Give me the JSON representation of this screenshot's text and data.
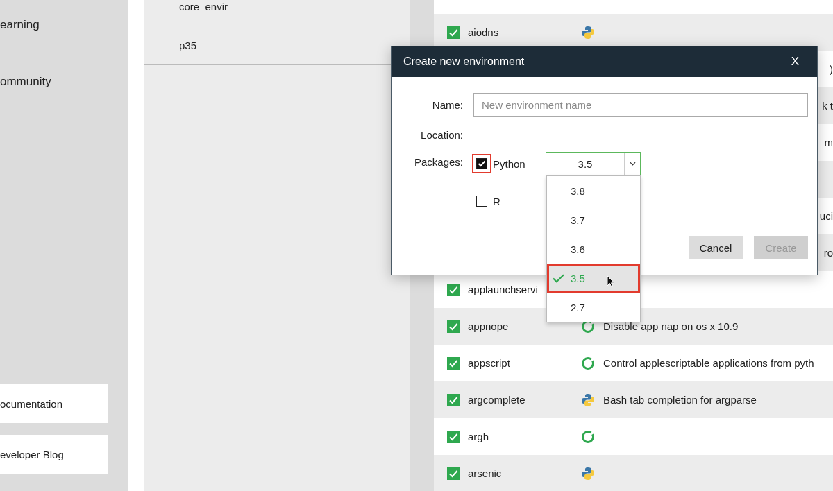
{
  "sidebar": {
    "items": [
      "earning",
      "ommunity"
    ],
    "links": [
      "ocumentation",
      "eveloper Blog"
    ]
  },
  "environments": {
    "items": [
      {
        "name": "core_envir"
      },
      {
        "name": "p35"
      }
    ]
  },
  "packages": {
    "rows": [
      {
        "name": "aiodns",
        "checked": true,
        "kind": "python"
      },
      {
        "description": ")"
      },
      {
        "description": "k t"
      },
      {
        "description": "m"
      },
      {},
      {
        "description": "uci"
      },
      {
        "description": "ro"
      },
      {
        "name": "applaunchservi",
        "checked": true
      },
      {
        "name": "appnope",
        "checked": true,
        "kind": "ring",
        "description": "Disable app nap on os x 10.9"
      },
      {
        "name": "appscript",
        "checked": true,
        "kind": "ring",
        "description": "Control applescriptable applications from pyth"
      },
      {
        "name": "argcomplete",
        "checked": true,
        "kind": "python",
        "description": "Bash tab completion for argparse"
      },
      {
        "name": "argh",
        "checked": true,
        "kind": "ring"
      },
      {
        "name": "arsenic",
        "checked": true,
        "kind": "python"
      }
    ]
  },
  "dialog": {
    "title": "Create new environment",
    "close": "X",
    "name_label": "Name:",
    "name_placeholder": "New environment name",
    "location_label": "Location:",
    "packages_label": "Packages:",
    "packages": [
      {
        "label": "Python",
        "checked": true,
        "highlighted": true
      },
      {
        "label": "R",
        "checked": false,
        "highlighted": false
      }
    ],
    "version": {
      "value": "3.5",
      "expanded": true,
      "options": [
        {
          "label": "3.8",
          "selected": false,
          "highlighted": false
        },
        {
          "label": "3.7",
          "selected": false,
          "highlighted": false
        },
        {
          "label": "3.6",
          "selected": false,
          "highlighted": false
        },
        {
          "label": "3.5",
          "selected": true,
          "highlighted": true
        },
        {
          "label": "2.7",
          "selected": false,
          "highlighted": false
        }
      ]
    },
    "buttons": [
      {
        "label": "Cancel",
        "disabled": false
      },
      {
        "label": "Create",
        "disabled": true
      }
    ]
  }
}
